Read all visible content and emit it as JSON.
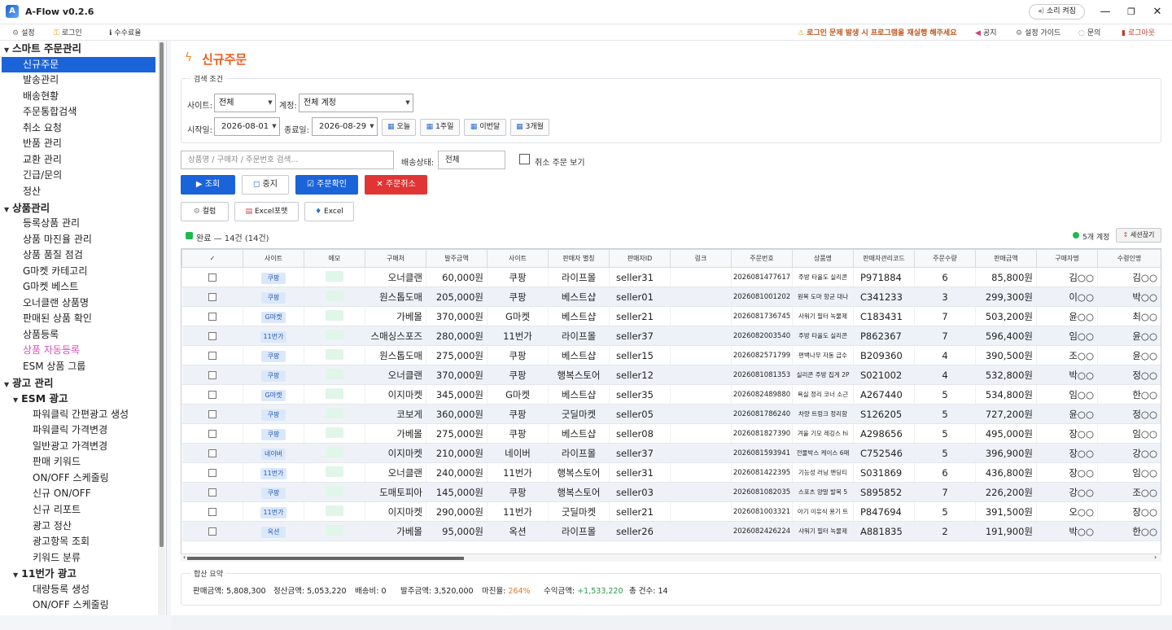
{
  "app": {
    "title": "A-Flow v0.2.6",
    "sound_label": "소리 켜짐"
  },
  "menubar": {
    "left": [
      {
        "name": "settings",
        "label": "설정",
        "icon": "gear-icon"
      },
      {
        "name": "login",
        "label": "로그인",
        "icon": "key-icon"
      },
      {
        "name": "fee-rate",
        "label": "수수료율",
        "icon": "info-icon"
      }
    ],
    "notice_warning": "로그인 문제 발생 시 프로그램을 재실행 해주세요",
    "right": [
      {
        "name": "notice",
        "label": "공지",
        "icon": "megaphone-icon"
      },
      {
        "name": "settings-guide",
        "label": "설정 가이드",
        "icon": "gear-icon"
      },
      {
        "name": "inquiry",
        "label": "문의",
        "icon": "chat-icon"
      },
      {
        "name": "logout",
        "label": "로그아웃",
        "icon": "door-icon"
      }
    ]
  },
  "sidebar": {
    "items": [
      {
        "label": "스마트 주문관리",
        "kind": "cat",
        "indent": 0
      },
      {
        "label": "신규주문",
        "kind": "sel",
        "indent": 1
      },
      {
        "label": "발송관리",
        "kind": "item",
        "indent": 1
      },
      {
        "label": "배송현황",
        "kind": "item",
        "indent": 1
      },
      {
        "label": "주문통합검색",
        "kind": "item",
        "indent": 1
      },
      {
        "label": "취소 요청",
        "kind": "item",
        "indent": 1
      },
      {
        "label": "반품 관리",
        "kind": "item",
        "indent": 1
      },
      {
        "label": "교환 관리",
        "kind": "item",
        "indent": 1
      },
      {
        "label": "긴급/문의",
        "kind": "item",
        "indent": 1
      },
      {
        "label": "정산",
        "kind": "item",
        "indent": 1
      },
      {
        "label": "상품관리",
        "kind": "cat",
        "indent": 0
      },
      {
        "label": "등록상품 관리",
        "kind": "item",
        "indent": 1
      },
      {
        "label": "상품 마진율 관리",
        "kind": "item",
        "indent": 1
      },
      {
        "label": "상품 품질 점검",
        "kind": "item",
        "indent": 1
      },
      {
        "label": "G마켓 카테고리",
        "kind": "item",
        "indent": 1
      },
      {
        "label": "G마켓 베스트",
        "kind": "item",
        "indent": 1
      },
      {
        "label": "오너클랜 상품명",
        "kind": "item",
        "indent": 1
      },
      {
        "label": "판매된 상품 확인",
        "kind": "item",
        "indent": 1
      },
      {
        "label": "상품등록",
        "kind": "item",
        "indent": 1
      },
      {
        "label": "상품 자동등록",
        "kind": "pink",
        "indent": 1
      },
      {
        "label": "ESM 상품 그룹",
        "kind": "item",
        "indent": 1
      },
      {
        "label": "광고 관리",
        "kind": "cat",
        "indent": 0
      },
      {
        "label": "ESM 광고",
        "kind": "cat",
        "indent": 1
      },
      {
        "label": "파워클릭 간편광고 생성",
        "kind": "item",
        "indent": 2
      },
      {
        "label": "파워클릭 가격변경",
        "kind": "item",
        "indent": 2
      },
      {
        "label": "일반광고 가격변경",
        "kind": "item",
        "indent": 2
      },
      {
        "label": "판매 키워드",
        "kind": "item",
        "indent": 2
      },
      {
        "label": "ON/OFF 스케줄링",
        "kind": "item",
        "indent": 2
      },
      {
        "label": "신규 ON/OFF",
        "kind": "item",
        "indent": 2
      },
      {
        "label": "신규 리포트",
        "kind": "item",
        "indent": 2
      },
      {
        "label": "광고 정산",
        "kind": "item",
        "indent": 2
      },
      {
        "label": "광고항목 조회",
        "kind": "item",
        "indent": 2
      },
      {
        "label": "키워드 분류",
        "kind": "item",
        "indent": 2
      },
      {
        "label": "11번가 광고",
        "kind": "cat",
        "indent": 1
      },
      {
        "label": "대량등록 생성",
        "kind": "item",
        "indent": 2
      },
      {
        "label": "ON/OFF 스케줄링",
        "kind": "item",
        "indent": 2
      }
    ]
  },
  "page": {
    "title": "신규주문"
  },
  "search": {
    "group_title": "검색 조건",
    "site_label": "사이트:",
    "site_value": "전체",
    "account_label": "계정:",
    "account_value": "전체 계정",
    "start_label": "시작일:",
    "start_value": "2026-08-01",
    "end_label": "종료일:",
    "end_value": "2026-08-29",
    "quick": [
      "오늘",
      "1주일",
      "이번달",
      "3개월"
    ],
    "keyword_placeholder": "상품명 / 구매자 / 주문번호 검색...",
    "ship_label": "배송상태:",
    "ship_value": "전체",
    "cancel_view_label": "취소 주문 보기"
  },
  "actions": {
    "query": "조회",
    "stop": "중지",
    "confirm": "주문확인",
    "cancel": "주문취소",
    "columns": "컬럼",
    "excel_format": "Excel포맷",
    "excel": "Excel"
  },
  "status": {
    "done_text": "완료 — 14건 (14건)",
    "accounts_text": "5개 계정",
    "pin_text": "세션끊기"
  },
  "grid": {
    "columns": [
      "✓",
      "사이트",
      "메모",
      "구매처",
      "발주금액",
      "사이트",
      "판매자 별칭",
      "판매자ID",
      "링크",
      "주문번호",
      "상품명",
      "판매자관리코드",
      "주문수량",
      "판매금액",
      "구매자명",
      "수령인명"
    ],
    "rows": [
      [
        "쿠팡",
        "오너클랜",
        "60,000원",
        "쿠팡",
        "라이프몰",
        "seller31",
        "2026081477617",
        "주방 타올도 실리콘",
        "P971884",
        "6",
        "85,800원",
        "김○○",
        "김○○"
      ],
      [
        "쿠팡",
        "원스톱도매",
        "205,000원",
        "쿠팡",
        "베스트샵",
        "seller01",
        "2026081001202",
        "원목 도마 항균 대나",
        "C341233",
        "3",
        "299,300원",
        "이○○",
        "박○○"
      ],
      [
        "G마켓",
        "가베몰",
        "370,000원",
        "G마켓",
        "베스트샵",
        "seller21",
        "2026081736745",
        "사워기 필터 녹물제",
        "C183431",
        "7",
        "503,200원",
        "윤○○",
        "최○○"
      ],
      [
        "11번가",
        "스매싱스포즈",
        "280,000원",
        "11번가",
        "라이프몰",
        "seller37",
        "2026082003540",
        "주방 타올도 실리콘",
        "P862367",
        "7",
        "596,400원",
        "임○○",
        "윤○○"
      ],
      [
        "쿠팡",
        "원스톱도매",
        "275,000원",
        "쿠팡",
        "베스트샵",
        "seller15",
        "2026082571799",
        "편백나무 자동 급수",
        "B209360",
        "4",
        "390,500원",
        "조○○",
        "윤○○"
      ],
      [
        "쿠팡",
        "오너클랜",
        "370,000원",
        "쿠팡",
        "행복스토어",
        "seller12",
        "2026081081353",
        "실리콘 주방 집게 2P",
        "S021002",
        "4",
        "532,800원",
        "박○○",
        "정○○"
      ],
      [
        "G마켓",
        "이지마켓",
        "345,000원",
        "G마켓",
        "베스트샵",
        "seller35",
        "2026082489880",
        "욕실 정리 코너 소근",
        "A267440",
        "5",
        "534,800원",
        "임○○",
        "한○○"
      ],
      [
        "쿠팡",
        "코보게",
        "360,000원",
        "쿠팡",
        "굿딜마켓",
        "seller05",
        "2026081786240",
        "차량 트렁크 정리함",
        "S126205",
        "5",
        "727,200원",
        "윤○○",
        "정○○"
      ],
      [
        "쿠팡",
        "가베몰",
        "275,000원",
        "쿠팡",
        "베스트샵",
        "seller08",
        "2026081827390",
        "겨울 기모 레깅스 hi",
        "A298656",
        "5",
        "495,000원",
        "장○○",
        "임○○"
      ],
      [
        "네이버",
        "이지마켓",
        "210,000원",
        "네이버",
        "라이프몰",
        "seller37",
        "2026081593941",
        "전물박스 케이스 6매",
        "C752546",
        "5",
        "396,900원",
        "장○○",
        "강○○"
      ],
      [
        "11번가",
        "오너클랜",
        "240,000원",
        "11번가",
        "행복스토어",
        "seller31",
        "2026081422395",
        "기능성 러닝 밴딩티",
        "S031869",
        "6",
        "436,800원",
        "장○○",
        "임○○"
      ],
      [
        "쿠팡",
        "도매토피아",
        "145,000원",
        "쿠팡",
        "행복스토어",
        "seller03",
        "2026081082035",
        "스포츠 양말 발목 5",
        "S895852",
        "7",
        "226,200원",
        "강○○",
        "조○○"
      ],
      [
        "11번가",
        "이지마켓",
        "290,000원",
        "11번가",
        "굿딜마켓",
        "seller21",
        "2026081003321",
        "아기 이유식 용기 트",
        "P847694",
        "5",
        "391,500원",
        "오○○",
        "장○○"
      ],
      [
        "옥션",
        "가베몰",
        "95,000원",
        "옥션",
        "라이프몰",
        "seller26",
        "2026082426224",
        "샤워기 필터 녹물제",
        "A881835",
        "2",
        "191,900원",
        "박○○",
        "한○○"
      ]
    ]
  },
  "summary": {
    "title": "합산 요약",
    "items": [
      {
        "text": "판매금액: 5,808,300",
        "color": "#333333"
      },
      {
        "text": "정산금액: 5,053,220",
        "color": "#333333"
      },
      {
        "text": "배송비: 0",
        "color": "#333333"
      },
      {
        "text": "발주금액: 3,520,000",
        "color": "#333333"
      }
    ],
    "margin_label": "마진율:",
    "margin_value": "264%",
    "margin_color": "#e3781f",
    "profit_label": "수익금액:",
    "profit_value": "+1,533,220",
    "profit_color": "#2a9a4a",
    "count_text": "총 건수: 14"
  },
  "colors": {
    "accent": "#1b63d8",
    "danger": "#e03535",
    "title": "#ef5a1c",
    "done": "#1fba4e"
  }
}
